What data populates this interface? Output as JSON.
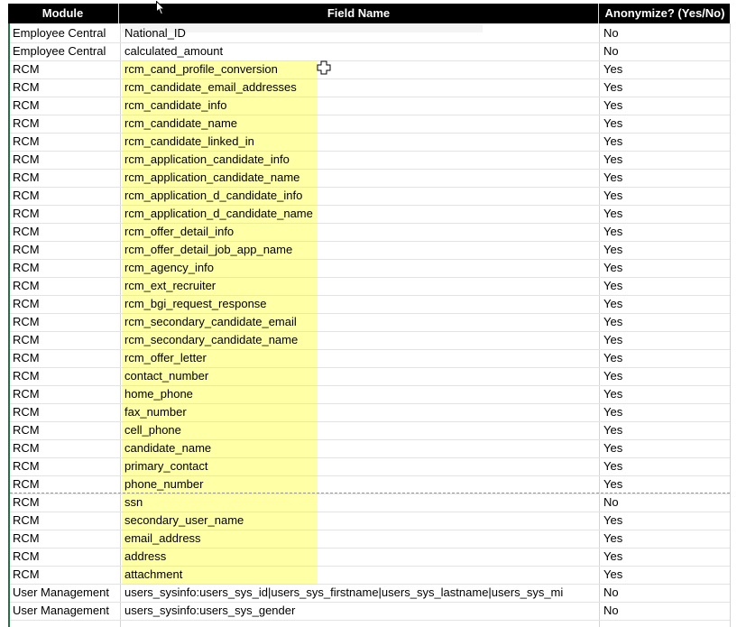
{
  "header": {
    "module": "Module",
    "field_name": "Field Name",
    "anonymize": "Anonymize? (Yes/No)"
  },
  "rows": [
    {
      "module": "Employee Central",
      "field": "National_ID",
      "anon": "No"
    },
    {
      "module": "Employee Central",
      "field": "calculated_amount",
      "anon": "No"
    },
    {
      "module": "RCM",
      "field": "rcm_cand_profile_conversion",
      "anon": "Yes"
    },
    {
      "module": "RCM",
      "field": "rcm_candidate_email_addresses",
      "anon": "Yes"
    },
    {
      "module": "RCM",
      "field": "rcm_candidate_info",
      "anon": "Yes"
    },
    {
      "module": "RCM",
      "field": "rcm_candidate_name",
      "anon": "Yes"
    },
    {
      "module": "RCM",
      "field": "rcm_candidate_linked_in",
      "anon": "Yes"
    },
    {
      "module": "RCM",
      "field": "rcm_application_candidate_info",
      "anon": "Yes"
    },
    {
      "module": "RCM",
      "field": "rcm_application_candidate_name",
      "anon": "Yes"
    },
    {
      "module": "RCM",
      "field": "rcm_application_d_candidate_info",
      "anon": "Yes"
    },
    {
      "module": "RCM",
      "field": "rcm_application_d_candidate_name",
      "anon": "Yes"
    },
    {
      "module": "RCM",
      "field": "rcm_offer_detail_info",
      "anon": "Yes"
    },
    {
      "module": "RCM",
      "field": "rcm_offer_detail_job_app_name",
      "anon": "Yes"
    },
    {
      "module": "RCM",
      "field": "rcm_agency_info",
      "anon": "Yes"
    },
    {
      "module": "RCM",
      "field": "rcm_ext_recruiter",
      "anon": "Yes"
    },
    {
      "module": "RCM",
      "field": "rcm_bgi_request_response",
      "anon": "Yes"
    },
    {
      "module": "RCM",
      "field": "rcm_secondary_candidate_email",
      "anon": "Yes"
    },
    {
      "module": "RCM",
      "field": "rcm_secondary_candidate_name",
      "anon": "Yes"
    },
    {
      "module": "RCM",
      "field": "rcm_offer_letter",
      "anon": "Yes"
    },
    {
      "module": "RCM",
      "field": "contact_number",
      "anon": "Yes"
    },
    {
      "module": "RCM",
      "field": "home_phone",
      "anon": "Yes"
    },
    {
      "module": "RCM",
      "field": "fax_number",
      "anon": "Yes"
    },
    {
      "module": "RCM",
      "field": "cell_phone",
      "anon": "Yes"
    },
    {
      "module": "RCM",
      "field": "candidate_name",
      "anon": "Yes"
    },
    {
      "module": "RCM",
      "field": "primary_contact",
      "anon": "Yes"
    },
    {
      "module": "RCM",
      "field": "phone_number",
      "anon": "Yes"
    },
    {
      "module": "RCM",
      "field": "ssn",
      "anon": "No"
    },
    {
      "module": "RCM",
      "field": "secondary_user_name",
      "anon": "Yes"
    },
    {
      "module": "RCM",
      "field": "email_address",
      "anon": "Yes"
    },
    {
      "module": "RCM",
      "field": "address",
      "anon": "Yes"
    },
    {
      "module": "RCM",
      "field": "attachment",
      "anon": "Yes"
    },
    {
      "module": "User Management",
      "field": "users_sysinfo:users_sys_id|users_sys_firstname|users_sys_lastname|users_sys_mi",
      "anon": "No"
    },
    {
      "module": "User Management",
      "field": "users_sysinfo:users_sys_gender",
      "anon": "No"
    }
  ]
}
